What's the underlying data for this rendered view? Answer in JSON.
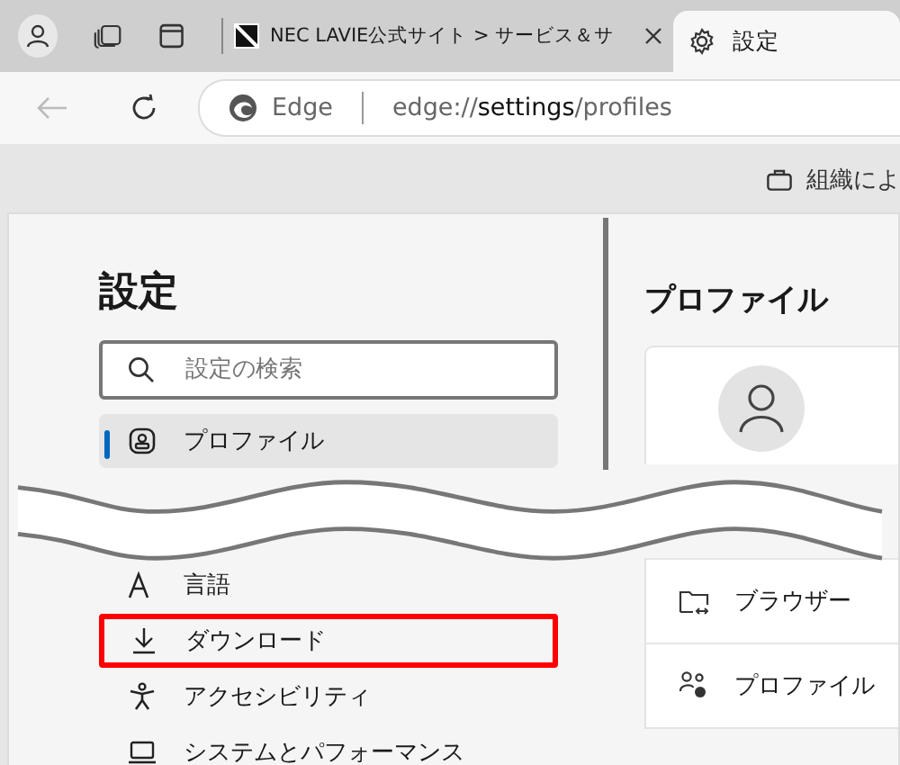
{
  "tabs": [
    {
      "label": "NEC LAVIE公式サイト > サービス＆サ",
      "selected": false
    },
    {
      "label": "設定",
      "selected": true
    }
  ],
  "address_bar": {
    "site_label": "Edge",
    "url_prefix": "edge://",
    "url_main": "settings",
    "url_suffix": "/profiles"
  },
  "toolbar": {
    "org_label": "組織によ"
  },
  "sidebar": {
    "title": "設定",
    "search": {
      "placeholder": "設定の検索"
    },
    "items": [
      {
        "label": "プロファイル",
        "selected": true,
        "highlighted": false
      },
      {
        "label": "言語",
        "selected": false,
        "highlighted": false
      },
      {
        "label": "ダウンロード",
        "selected": false,
        "highlighted": true
      },
      {
        "label": "アクセシビリティ",
        "selected": false,
        "highlighted": false
      },
      {
        "label": "システムとパフォーマンス",
        "selected": false,
        "highlighted": false
      }
    ]
  },
  "main": {
    "title": "プロファイル",
    "rows": [
      {
        "label": "ブラウザー"
      },
      {
        "label": "プロファイル"
      }
    ]
  }
}
